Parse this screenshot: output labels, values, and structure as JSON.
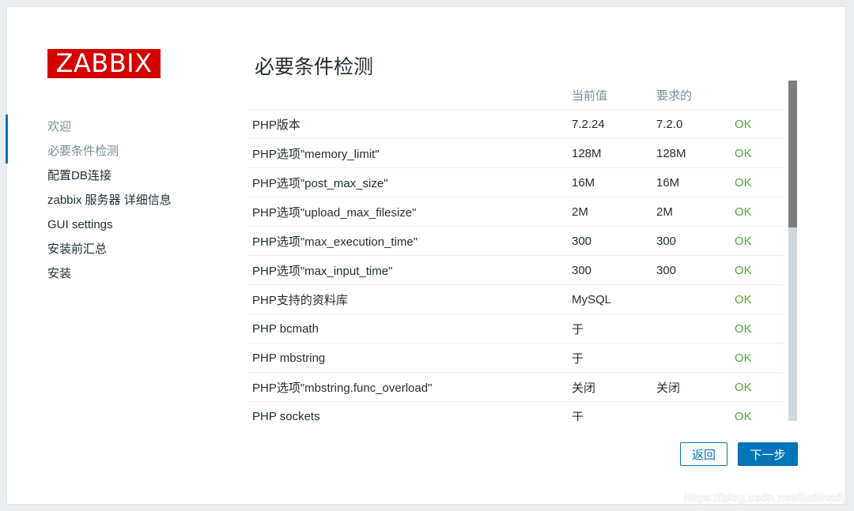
{
  "logo_text": "ZABBIX",
  "nav": [
    {
      "label": "欢迎"
    },
    {
      "label": "必要条件检测"
    },
    {
      "label": "配置DB连接"
    },
    {
      "label": "zabbix 服务器 详细信息"
    },
    {
      "label": "GUI settings"
    },
    {
      "label": "安装前汇总"
    },
    {
      "label": "安装"
    }
  ],
  "page_title": "必要条件检测",
  "table": {
    "headers": [
      "",
      "当前值",
      "要求的",
      ""
    ],
    "rows": [
      {
        "name": "PHP版本",
        "current": "7.2.24",
        "required": "7.2.0",
        "status": "OK"
      },
      {
        "name": "PHP选项\"memory_limit\"",
        "current": "128M",
        "required": "128M",
        "status": "OK"
      },
      {
        "name": "PHP选项\"post_max_size\"",
        "current": "16M",
        "required": "16M",
        "status": "OK"
      },
      {
        "name": "PHP选项\"upload_max_filesize\"",
        "current": "2M",
        "required": "2M",
        "status": "OK"
      },
      {
        "name": "PHP选项\"max_execution_time\"",
        "current": "300",
        "required": "300",
        "status": "OK"
      },
      {
        "name": "PHP选项\"max_input_time\"",
        "current": "300",
        "required": "300",
        "status": "OK"
      },
      {
        "name": "PHP支持的资料库",
        "current": "MySQL",
        "required": "",
        "status": "OK"
      },
      {
        "name": "PHP bcmath",
        "current": "于",
        "required": "",
        "status": "OK"
      },
      {
        "name": "PHP mbstring",
        "current": "于",
        "required": "",
        "status": "OK"
      },
      {
        "name": "PHP选项\"mbstring.func_overload\"",
        "current": "关闭",
        "required": "关闭",
        "status": "OK"
      },
      {
        "name": "PHP sockets",
        "current": "于",
        "required": "",
        "status": "OK"
      }
    ]
  },
  "buttons": {
    "back": "返回",
    "next": "下一步"
  },
  "watermark": "https://blog.csdn.net/liudihedy",
  "colors": {
    "brand": "#d40000",
    "accent": "#0275b8",
    "ok": "#59a340",
    "muted": "#768d99"
  }
}
